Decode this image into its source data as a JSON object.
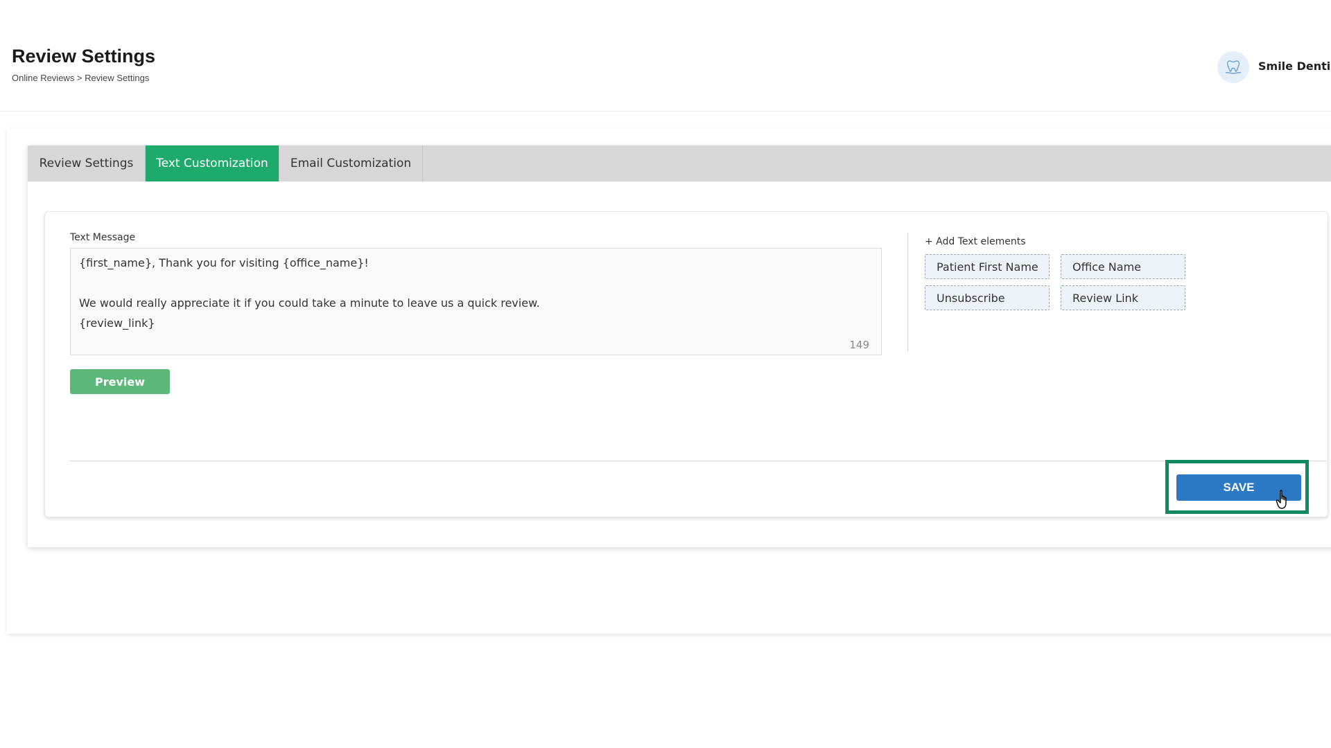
{
  "header": {
    "title": "Review Settings",
    "breadcrumb": "Online Reviews > Review Settings",
    "office_name": "Smile Dentis",
    "avatar_icon": "tooth-hand-icon"
  },
  "tabs": [
    {
      "label": "Review Settings",
      "active": false
    },
    {
      "label": "Text Customization",
      "active": true
    },
    {
      "label": "Email Customization",
      "active": false
    }
  ],
  "text_message": {
    "label": "Text Message",
    "value": "{first_name}, Thank you for visiting {office_name}!\n\nWe would really appreciate it if you could take a minute to leave us a quick review.\n{review_link}",
    "char_count": "149"
  },
  "preview_label": "Preview",
  "text_elements": {
    "header": "+ Add Text elements",
    "items": [
      "Patient First Name",
      "Office Name",
      "Unsubscribe",
      "Review Link"
    ]
  },
  "save_label": "SAVE",
  "colors": {
    "active_tab": "#1eaa6d",
    "preview_button": "#5cb87a",
    "save_button": "#2b78c5",
    "save_highlight": "#0f8a5f"
  }
}
